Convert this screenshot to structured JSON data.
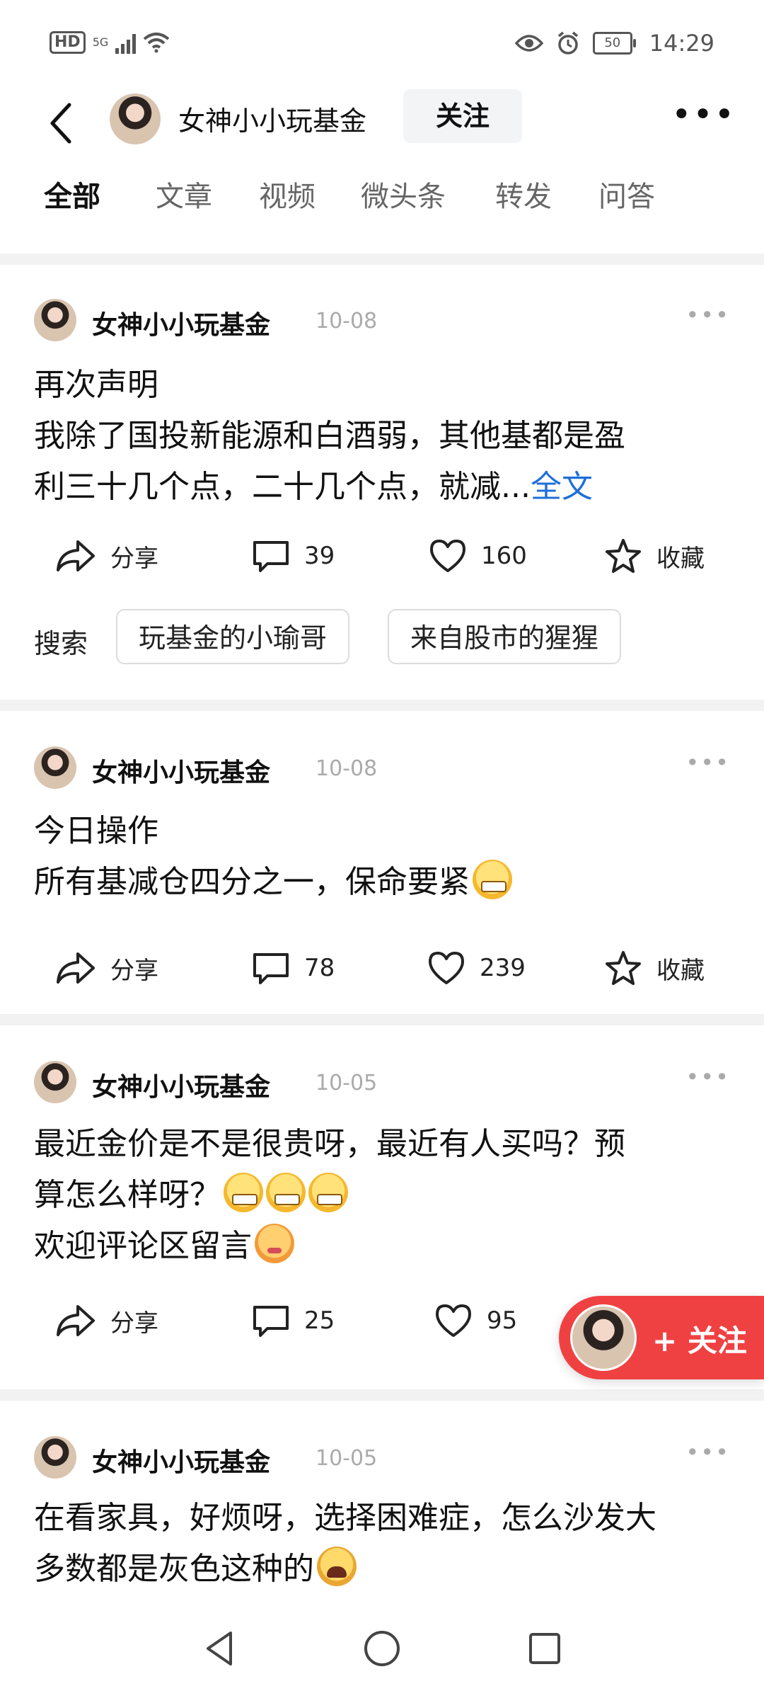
{
  "status_bar": {
    "network_hd": "HD",
    "network_5g": "5G",
    "battery": "50",
    "time": "14:29"
  },
  "header": {
    "account_name": "女神小小玩基金",
    "follow_label": "关注"
  },
  "tabs": [
    {
      "label": "全部",
      "active": true
    },
    {
      "label": "文章",
      "active": false
    },
    {
      "label": "视频",
      "active": false
    },
    {
      "label": "微头条",
      "active": false
    },
    {
      "label": "转发",
      "active": false
    },
    {
      "label": "问答",
      "active": false
    }
  ],
  "posts": [
    {
      "author": "女神小小玩基金",
      "date": "10-08",
      "lines": [
        "再次声明",
        "我除了国投新能源和白酒弱，其他基都是盈",
        "利三十几个点，二十几个点，就减..."
      ],
      "full_text_link": "全文",
      "share": "分享",
      "comments": "39",
      "likes": "160",
      "favorite": "收藏",
      "search": {
        "label": "搜索",
        "chips": [
          "玩基金的小瑜哥",
          "来自股市的猩猩"
        ]
      }
    },
    {
      "author": "女神小小玩基金",
      "date": "10-08",
      "lines": [
        "今日操作",
        "所有基减仓四分之一，保命要紧"
      ],
      "share": "分享",
      "comments": "78",
      "likes": "239",
      "favorite": "收藏"
    },
    {
      "author": "女神小小玩基金",
      "date": "10-05",
      "lines": [
        "最近金价是不是很贵呀，最近有人买吗？预",
        "算怎么样呀？",
        "欢迎评论区留言"
      ],
      "share": "分享",
      "comments": "25",
      "likes": "95"
    },
    {
      "author": "女神小小玩基金",
      "date": "10-05",
      "lines": [
        "在看家具，好烦呀，选择困难症，怎么沙发大",
        "多数都是灰色这种的"
      ]
    }
  ],
  "floating_follow": {
    "label": "+ 关注",
    "color": "#f04142"
  },
  "icons": [
    "back-arrow-icon",
    "more-icon",
    "share-icon",
    "comment-icon",
    "like-icon",
    "favorite-icon",
    "nav-back-icon",
    "nav-home-icon",
    "nav-recents-icon"
  ]
}
